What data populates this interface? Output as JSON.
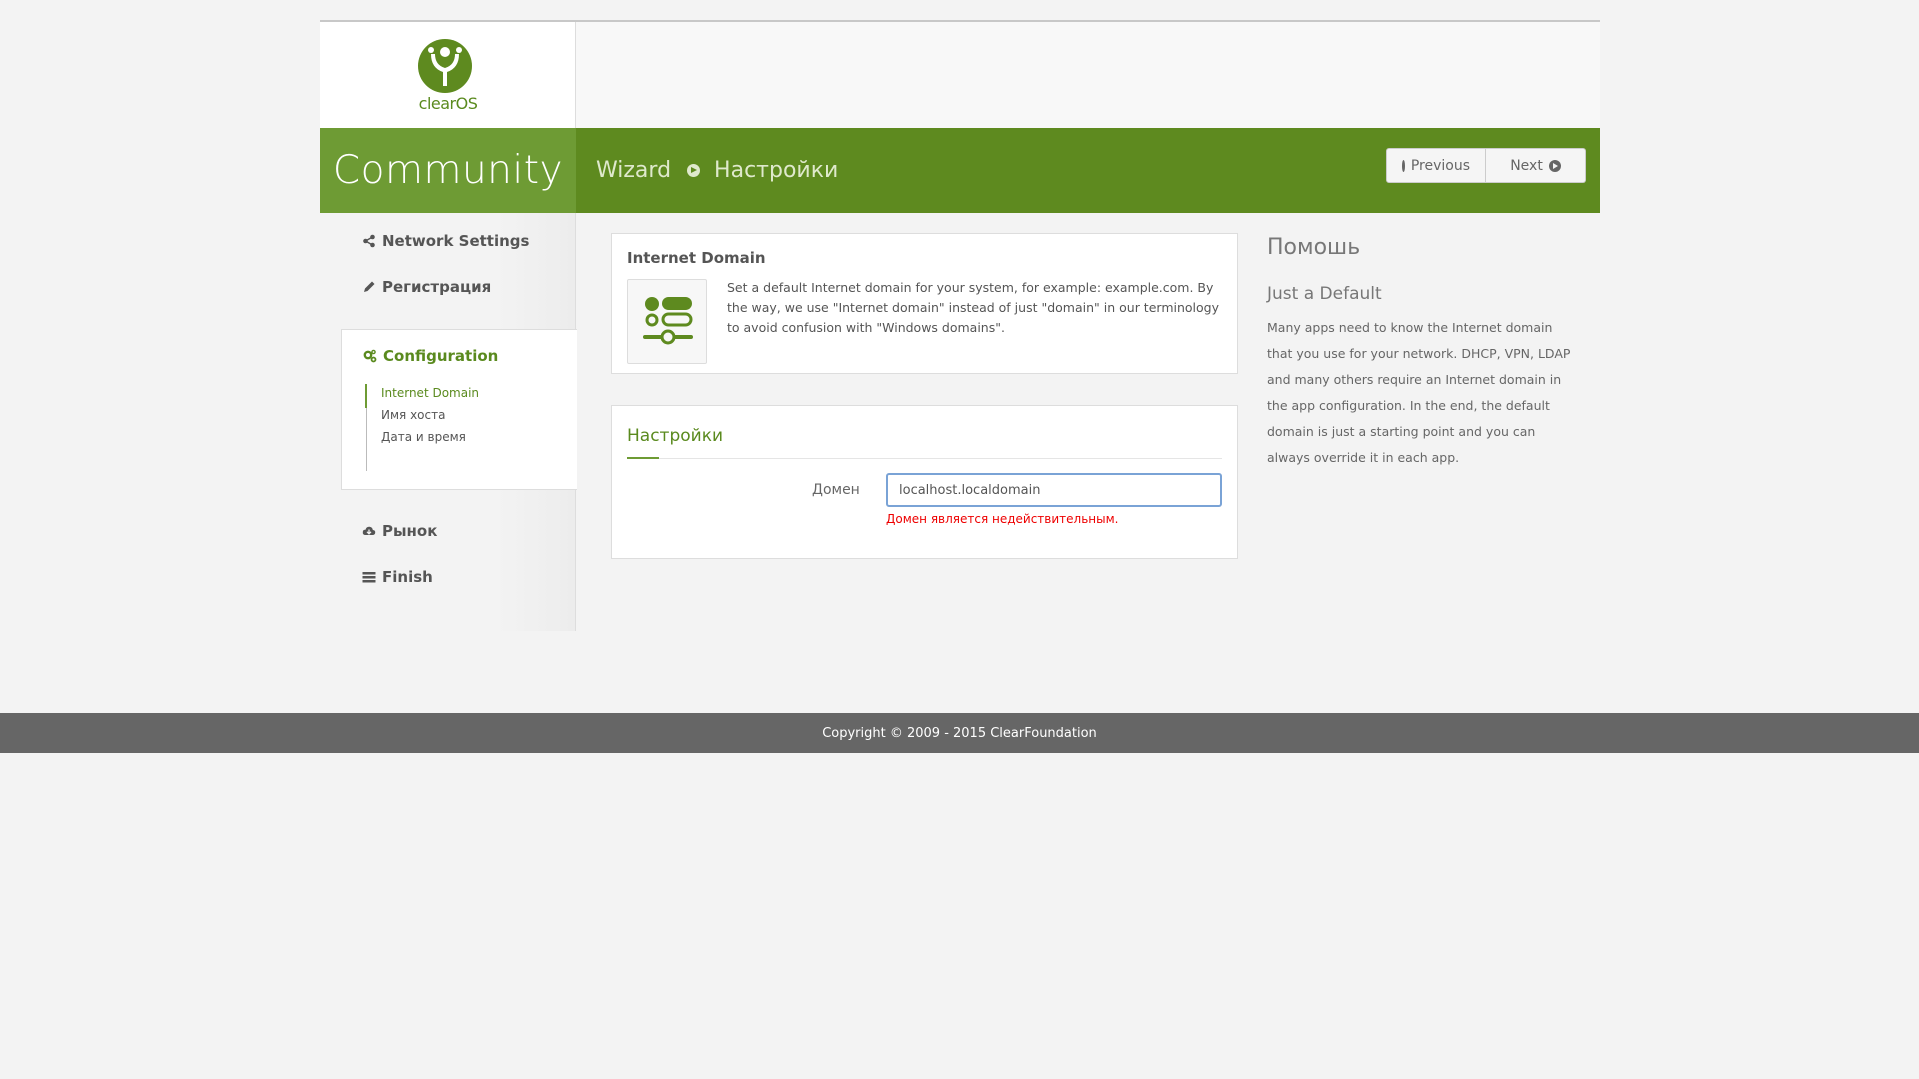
{
  "logo": {
    "text": "clearOS"
  },
  "banner": {
    "edition": "Community",
    "breadcrumb": [
      "Wizard",
      "Настройки"
    ],
    "buttons": {
      "previous": "Previous",
      "next": "Next"
    }
  },
  "sidebar": {
    "items": [
      {
        "label": "Network Settings",
        "icon": "share-icon"
      },
      {
        "label": "Регистрация",
        "icon": "pencil-icon"
      },
      {
        "label": "Configuration",
        "icon": "gears-icon",
        "active": true,
        "subitems": [
          "Internet Domain",
          "Имя хоста",
          "Дата и время"
        ]
      },
      {
        "label": "Рынок",
        "icon": "cloud-download-icon"
      },
      {
        "label": "Finish",
        "icon": "tasks-icon"
      }
    ]
  },
  "info": {
    "title": "Internet Domain",
    "text": "Set a default Internet domain for your system, for example: example.com. By the way, we use \"Internet domain\" instead of just \"domain\" in our terminology to avoid confusion with \"Windows domains\"."
  },
  "form": {
    "title": "Настройки",
    "label": "Домен",
    "value": "localhost.localdomain",
    "error": "Домен является недействительным."
  },
  "help": {
    "title": "Помошь",
    "subtitle": "Just a Default",
    "text": "Many apps need to know the Internet domain that you use for your network. DHCP, VPN, LDAP and many others require an Internet domain in the app configuration. In the end, the default domain is just a starting point and you can always override it in each app."
  },
  "footer": {
    "text": "Copyright © 2009 - 2015 ClearFoundation"
  },
  "colors": {
    "brand": "#5e8a1f",
    "brand_light": "#6e9b34",
    "error": "#ee0000",
    "footer": "#666666"
  }
}
